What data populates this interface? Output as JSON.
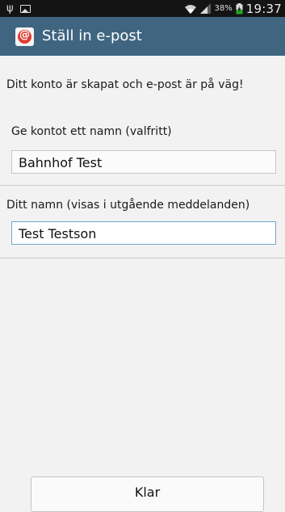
{
  "status_bar": {
    "usb_icon": "usb-icon",
    "image_icon": "image-notification-icon",
    "wifi_icon": "wifi-icon",
    "signal_icon": "signal-icon",
    "battery_percent": "38%",
    "time": "19:37"
  },
  "action_bar": {
    "icon": "email-app-icon",
    "icon_glyph": "@",
    "title": "Ställ in e-post",
    "color": "#3f6580"
  },
  "main": {
    "message": "Ditt konto är skapat och e-post är på väg!",
    "account_name_label": "Ge kontot ett namn (valfritt)",
    "account_name_value": "Bahnhof Test",
    "your_name_label": "Ditt namn (visas i utgående meddelanden)",
    "your_name_value": "Test Testson"
  },
  "footer": {
    "done_label": "Klar"
  }
}
